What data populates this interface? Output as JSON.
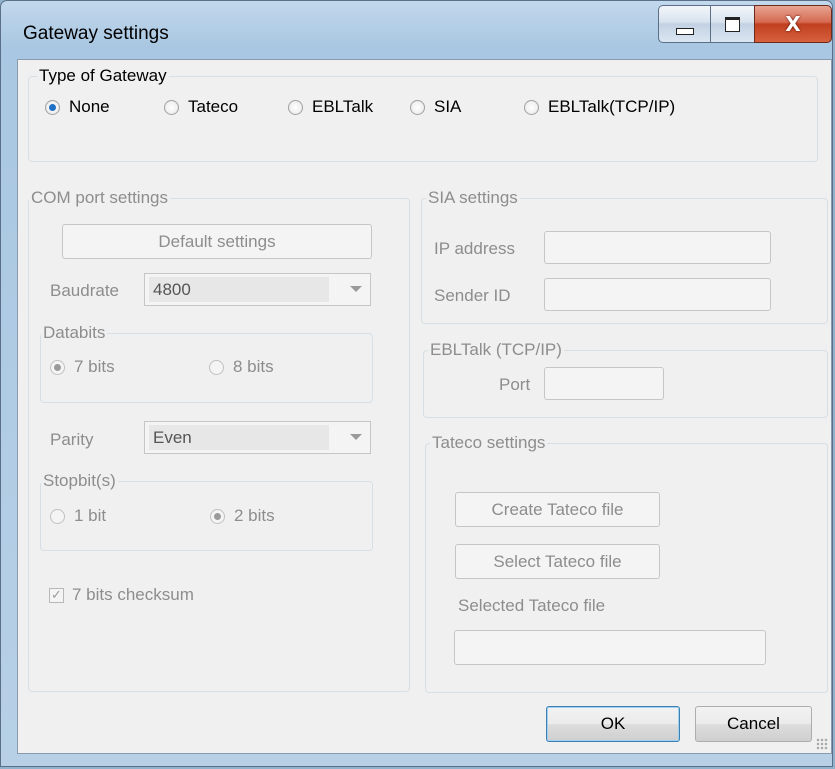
{
  "window": {
    "title": "Gateway settings"
  },
  "icons": {
    "minimize": "minimize-icon",
    "maximize": "maximize-icon",
    "close": "close-icon"
  },
  "close_glyph": "X",
  "gateway_type": {
    "legend": "Type of Gateway",
    "options": [
      "None",
      "Tateco",
      "EBLTalk",
      "SIA",
      "EBLTalk(TCP/IP)"
    ],
    "selected": "None"
  },
  "com_port": {
    "legend": "COM port settings",
    "default_button": "Default settings",
    "baudrate_label": "Baudrate",
    "baudrate_value": "4800",
    "databits": {
      "legend": "Databits",
      "opt1": "7 bits",
      "opt2": "8 bits",
      "selected": "7 bits"
    },
    "parity_label": "Parity",
    "parity_value": "Even",
    "stopbits": {
      "legend": "Stopbit(s)",
      "opt1": "1 bit",
      "opt2": "2 bits",
      "selected": "2 bits"
    },
    "checksum_label": "7 bits checksum",
    "checksum_checked": true
  },
  "sia": {
    "legend": "SIA settings",
    "ip_label": "IP address",
    "ip_value": "",
    "sender_label": "Sender ID",
    "sender_value": ""
  },
  "ebltalk_tcp": {
    "legend": "EBLTalk (TCP/IP)",
    "port_label": "Port",
    "port_value": ""
  },
  "tateco": {
    "legend": "Tateco settings",
    "create_button": "Create Tateco file",
    "select_button": "Select Tateco file",
    "selected_label": "Selected Tateco file",
    "selected_value": ""
  },
  "footer": {
    "ok": "OK",
    "cancel": "Cancel"
  },
  "colors": {
    "title_bar": "#b7d0e6",
    "dialog_bg": "#f0f0f0",
    "close_button": "#c0401f",
    "radio_selected": "#1f6fc4",
    "disabled_text": "#8d8d8d"
  }
}
